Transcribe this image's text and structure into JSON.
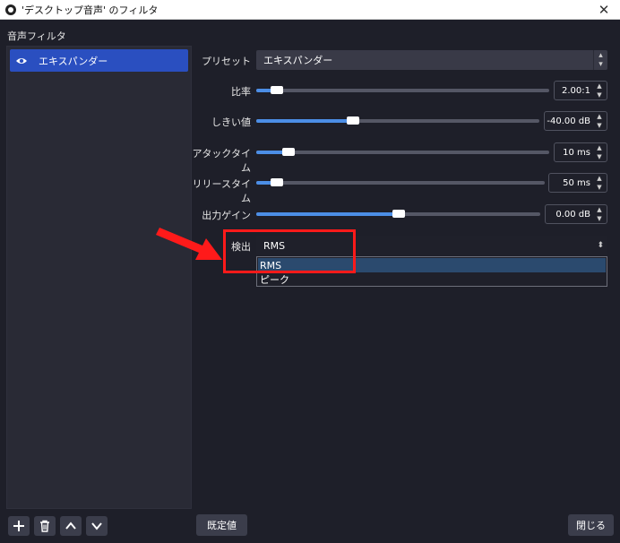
{
  "window": {
    "title": "'デスクトップ音声' のフィルタ",
    "close": "✕"
  },
  "section_label": "音声フィルタ",
  "filters": [
    {
      "label": "エキスパンダー"
    }
  ],
  "props": {
    "preset_label": "プリセット",
    "preset_value": "エキスパンダー",
    "ratio_label": "比率",
    "ratio_value": "2.00:1",
    "threshold_label": "しきい値",
    "threshold_value": "-40.00 dB",
    "attack_label": "アタックタイム",
    "attack_value": "10 ms",
    "release_label": "リリースタイム",
    "release_value": "50 ms",
    "output_label": "出力ゲイン",
    "output_value": "0.00 dB",
    "detect_label": "検出",
    "detect_value": "RMS",
    "detect_options": [
      "RMS",
      "ピーク"
    ]
  },
  "buttons": {
    "defaults": "既定値",
    "close": "閉じる"
  },
  "colors": {
    "accent": "#2a4fc0",
    "slider": "#4c8ee6",
    "highlight": "#ff1a1a"
  }
}
